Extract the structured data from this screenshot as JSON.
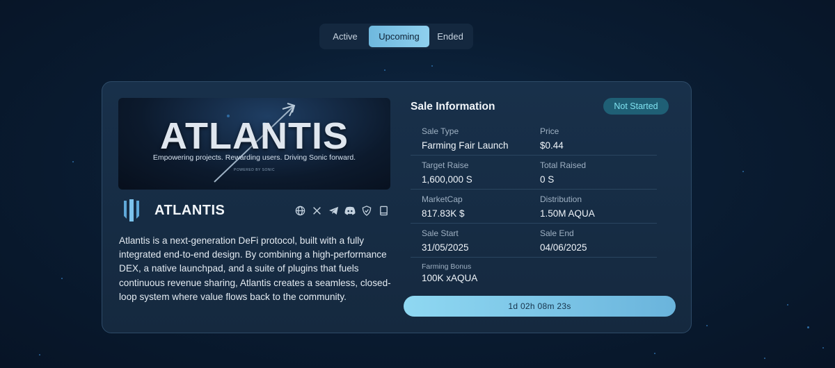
{
  "tabs": [
    {
      "label": "Active"
    },
    {
      "label": "Upcoming"
    },
    {
      "label": "Ended"
    }
  ],
  "banner": {
    "title": "ATLANTIS",
    "tagline": "Empowering projects. Rewarding users. Driving Sonic forward.",
    "powered": "POWERED BY SONIC"
  },
  "project": {
    "name": "ATLANTIS",
    "description": "Atlantis is a next-generation DeFi protocol, built with a fully integrated end-to-end design. By combining a high-performance DEX, a native launchpad, and a suite of plugins that fuels continuous revenue sharing, Atlantis creates a seamless, closed-loop system where value flows back to the community.",
    "socials": [
      "globe-icon",
      "x-icon",
      "telegram-icon",
      "discord-icon",
      "shield-icon",
      "book-icon"
    ]
  },
  "sale": {
    "title": "Sale Information",
    "status": "Not Started",
    "sale_type_label": "Sale Type",
    "sale_type": "Farming Fair Launch",
    "price_label": "Price",
    "price": "$0.44",
    "target_raise_label": "Target Raise",
    "target_raise": "1,600,000 S",
    "total_raised_label": "Total Raised",
    "total_raised": "0 S",
    "marketcap_label": "MarketCap",
    "marketcap": "817.83K $",
    "distribution_label": "Distribution",
    "distribution": "1.50M AQUA",
    "sale_start_label": "Sale Start",
    "sale_start": "31/05/2025",
    "sale_end_label": "Sale End",
    "sale_end": "04/06/2025",
    "farming_bonus_label": "Farming Bonus",
    "farming_bonus": "100K xAQUA"
  },
  "countdown": "1d 02h 08m 23s",
  "colors": {
    "accent": "#8fd0ee",
    "badge_bg": "#1f5f75",
    "badge_text": "#7fe2f0",
    "card_bg": "#18304a"
  }
}
